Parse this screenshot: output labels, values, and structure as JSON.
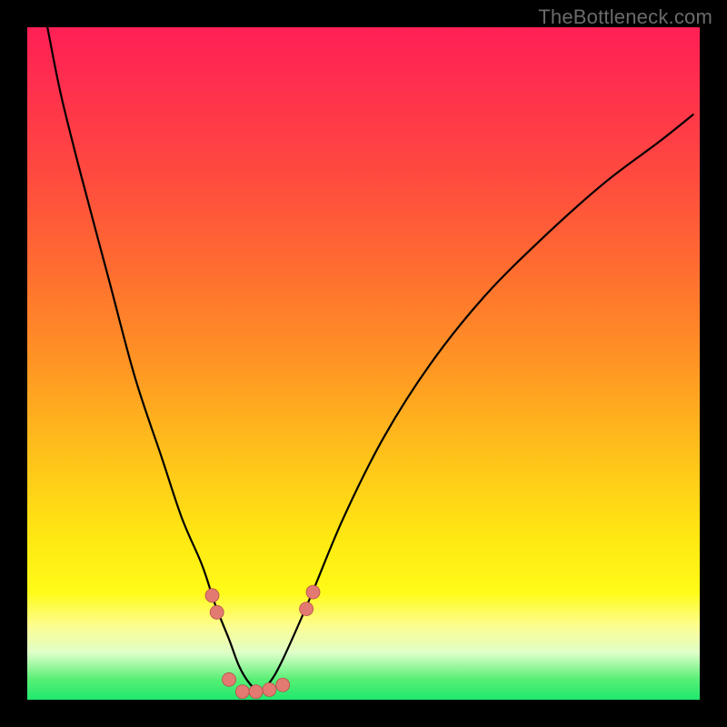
{
  "watermark": "TheBottleneck.com",
  "colors": {
    "frame_bg": "#000000",
    "gradient_stops": [
      {
        "pos": 0,
        "color": "#ff1f55"
      },
      {
        "pos": 8,
        "color": "#ff2e4e"
      },
      {
        "pos": 22,
        "color": "#ff4a3f"
      },
      {
        "pos": 36,
        "color": "#ff6d30"
      },
      {
        "pos": 50,
        "color": "#ff9524"
      },
      {
        "pos": 64,
        "color": "#ffc31a"
      },
      {
        "pos": 76,
        "color": "#ffe812"
      },
      {
        "pos": 84,
        "color": "#fffb18"
      },
      {
        "pos": 89,
        "color": "#fdfd90"
      },
      {
        "pos": 93,
        "color": "#dfffc9"
      },
      {
        "pos": 97,
        "color": "#57ef75"
      },
      {
        "pos": 100,
        "color": "#1fe86e"
      }
    ],
    "curve": "#000000",
    "dot_fill": "#e37a72",
    "dot_stroke": "#b74f49"
  },
  "chart_data": {
    "type": "line",
    "title": "",
    "xlabel": "",
    "ylabel": "",
    "xlim": [
      0,
      100
    ],
    "ylim": [
      0,
      100
    ],
    "note": "Axes unlabeled; x/y are normalized 0–100 over visible plot area (0,0 = top-left).",
    "series": [
      {
        "name": "curve",
        "x": [
          3,
          5,
          8,
          12,
          16,
          20,
          23,
          26,
          28,
          30,
          31.5,
          33,
          34.5,
          36,
          38,
          42,
          47,
          53,
          60,
          68,
          77,
          86,
          94,
          99
        ],
        "y": [
          0,
          10,
          22,
          37,
          52,
          64,
          73,
          80,
          86,
          91,
          95,
          97.5,
          98.7,
          97.5,
          94,
          85,
          73,
          61,
          50,
          40,
          31,
          23,
          17,
          13
        ]
      }
    ],
    "markers": [
      {
        "x": 27.5,
        "y": 84.5
      },
      {
        "x": 28.2,
        "y": 87.0
      },
      {
        "x": 30.0,
        "y": 97.0
      },
      {
        "x": 32.0,
        "y": 98.8
      },
      {
        "x": 34.0,
        "y": 98.8
      },
      {
        "x": 36.0,
        "y": 98.5
      },
      {
        "x": 38.0,
        "y": 97.8
      },
      {
        "x": 41.5,
        "y": 86.5
      },
      {
        "x": 42.5,
        "y": 84.0
      }
    ]
  }
}
